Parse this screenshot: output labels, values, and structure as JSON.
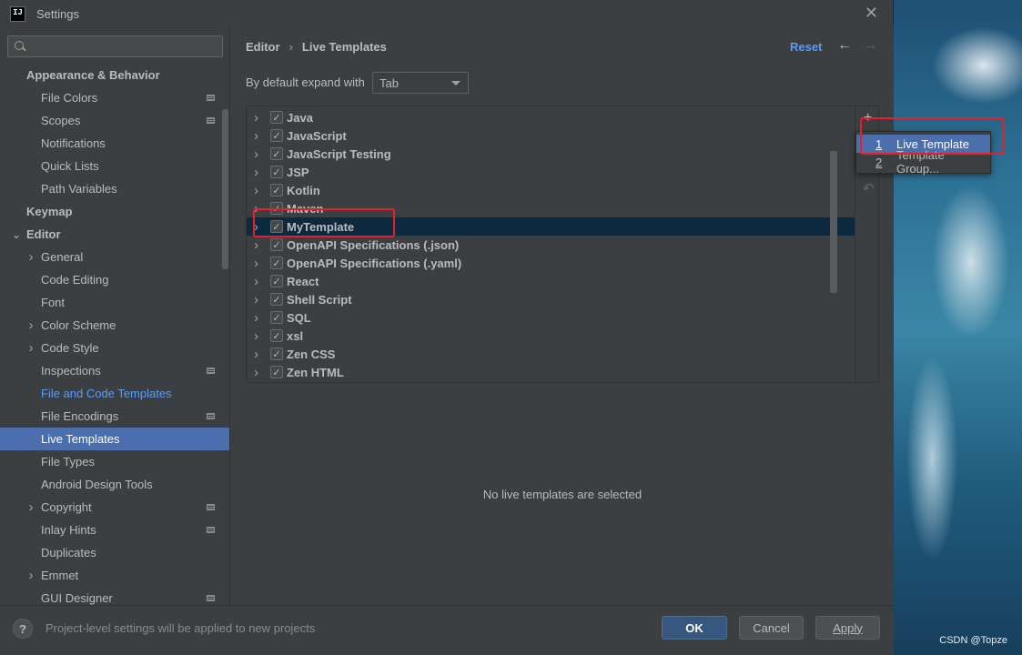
{
  "window": {
    "title": "Settings",
    "app_icon": "IJ"
  },
  "search": {
    "placeholder": "",
    "value": ""
  },
  "sidebar": {
    "items": [
      {
        "label": "Appearance & Behavior",
        "level": 0,
        "bold": true,
        "expand": "none",
        "scope_icon": false
      },
      {
        "label": "File Colors",
        "level": 1,
        "scope_icon": true
      },
      {
        "label": "Scopes",
        "level": 1,
        "scope_icon": true
      },
      {
        "label": "Notifications",
        "level": 1,
        "scope_icon": false
      },
      {
        "label": "Quick Lists",
        "level": 1,
        "scope_icon": false
      },
      {
        "label": "Path Variables",
        "level": 1,
        "scope_icon": false
      },
      {
        "label": "Keymap",
        "level": 0,
        "bold": true,
        "scope_icon": false
      },
      {
        "label": "Editor",
        "level": 0,
        "bold": true,
        "expand": "expanded",
        "scope_icon": false
      },
      {
        "label": "General",
        "level": 1,
        "expand": "collapsed",
        "scope_icon": false
      },
      {
        "label": "Code Editing",
        "level": 1,
        "scope_icon": false
      },
      {
        "label": "Font",
        "level": 1,
        "scope_icon": false
      },
      {
        "label": "Color Scheme",
        "level": 1,
        "expand": "collapsed",
        "scope_icon": false
      },
      {
        "label": "Code Style",
        "level": 1,
        "expand": "collapsed",
        "scope_icon": false
      },
      {
        "label": "Inspections",
        "level": 1,
        "scope_icon": true
      },
      {
        "label": "File and Code Templates",
        "level": 1,
        "link": true,
        "scope_icon": false
      },
      {
        "label": "File Encodings",
        "level": 1,
        "scope_icon": true
      },
      {
        "label": "Live Templates",
        "level": 1,
        "selected": true,
        "scope_icon": false
      },
      {
        "label": "File Types",
        "level": 1,
        "scope_icon": false
      },
      {
        "label": "Android Design Tools",
        "level": 1,
        "scope_icon": false
      },
      {
        "label": "Copyright",
        "level": 1,
        "expand": "collapsed",
        "scope_icon": true
      },
      {
        "label": "Inlay Hints",
        "level": 1,
        "scope_icon": true
      },
      {
        "label": "Duplicates",
        "level": 1,
        "scope_icon": false
      },
      {
        "label": "Emmet",
        "level": 1,
        "expand": "collapsed",
        "scope_icon": false
      },
      {
        "label": "GUI Designer",
        "level": 1,
        "scope_icon": true
      }
    ]
  },
  "breadcrumb": {
    "parent": "Editor",
    "separator": "›",
    "current": "Live Templates"
  },
  "header": {
    "reset_label": "Reset",
    "back_glyph": "←",
    "forward_glyph": "→"
  },
  "expand": {
    "label": "By default expand with",
    "selected": "Tab"
  },
  "template_groups": [
    {
      "name": "Java",
      "checked": true
    },
    {
      "name": "JavaScript",
      "checked": true
    },
    {
      "name": "JavaScript Testing",
      "checked": true
    },
    {
      "name": "JSP",
      "checked": true
    },
    {
      "name": "Kotlin",
      "checked": true
    },
    {
      "name": "Maven",
      "checked": true
    },
    {
      "name": "MyTemplate",
      "checked": true,
      "selected": true
    },
    {
      "name": "OpenAPI Specifications (.json)",
      "checked": true
    },
    {
      "name": "OpenAPI Specifications (.yaml)",
      "checked": true
    },
    {
      "name": "React",
      "checked": true
    },
    {
      "name": "Shell Script",
      "checked": true
    },
    {
      "name": "SQL",
      "checked": true
    },
    {
      "name": "xsl",
      "checked": true
    },
    {
      "name": "Zen CSS",
      "checked": true
    },
    {
      "name": "Zen HTML",
      "checked": true
    }
  ],
  "toolbar": {
    "add_glyph": "+",
    "undo_glyph": "↶"
  },
  "popup": {
    "items": [
      {
        "mnemonic": "1",
        "label": "Live Template",
        "selected": true
      },
      {
        "mnemonic": "2",
        "label": "Template Group...",
        "selected": false
      }
    ]
  },
  "details": {
    "empty_text": "No live templates are selected"
  },
  "footer": {
    "help_glyph": "?",
    "hint": "Project-level settings will be applied to new projects",
    "ok_label": "OK",
    "cancel_label": "Cancel",
    "apply_label": "Apply"
  },
  "watermark": "CSDN @Topze",
  "colors": {
    "accent": "#4b6eaf",
    "link": "#589df6",
    "selection_dark": "#0d293e",
    "highlight_box": "#e5202a"
  }
}
